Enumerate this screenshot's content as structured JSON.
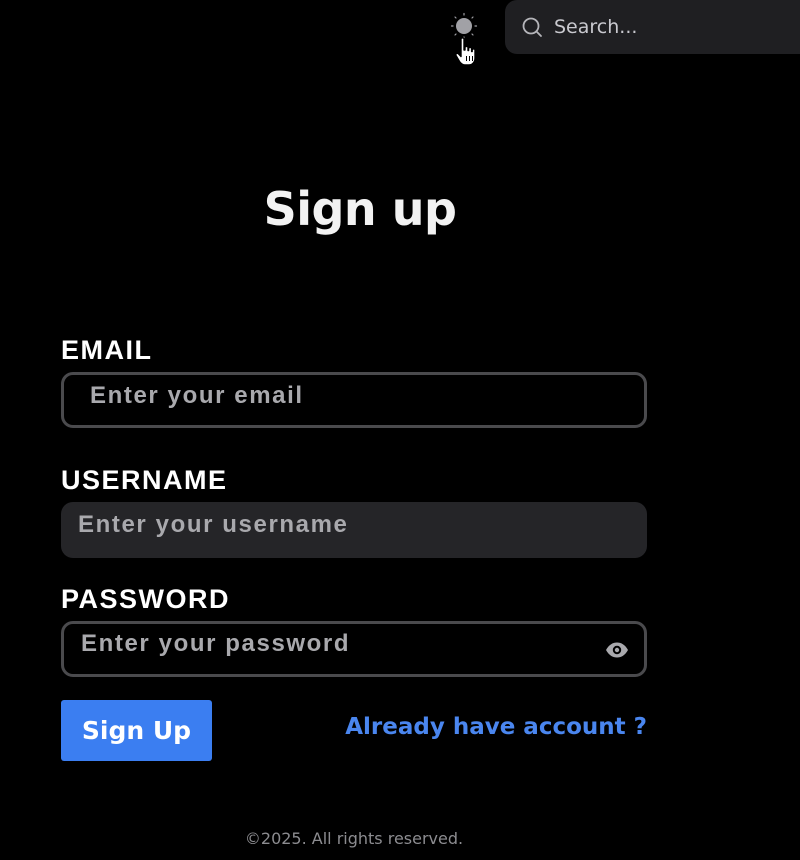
{
  "header": {
    "theme_toggle_icon": "sun-icon",
    "search": {
      "icon": "search-icon",
      "placeholder": "Search..."
    }
  },
  "form": {
    "title": "Sign up",
    "email": {
      "label": "EMAIL",
      "placeholder": "Enter your email",
      "value": ""
    },
    "username": {
      "label": "USERNAME",
      "placeholder": "Enter your username",
      "value": ""
    },
    "password": {
      "label": "PASSWORD",
      "placeholder": "Enter your password",
      "value": "",
      "toggle_icon": "eye-icon"
    },
    "submit_label": "Sign Up",
    "login_link": "Already have account ?"
  },
  "footer": {
    "copyright": "©2025. All rights reserved."
  },
  "colors": {
    "background": "#000000",
    "accent": "#3b7ef1",
    "link": "#4a86ef",
    "input_border": "#4a4a4d",
    "input_filled_bg": "#252528",
    "search_bg": "#1f1f22"
  }
}
